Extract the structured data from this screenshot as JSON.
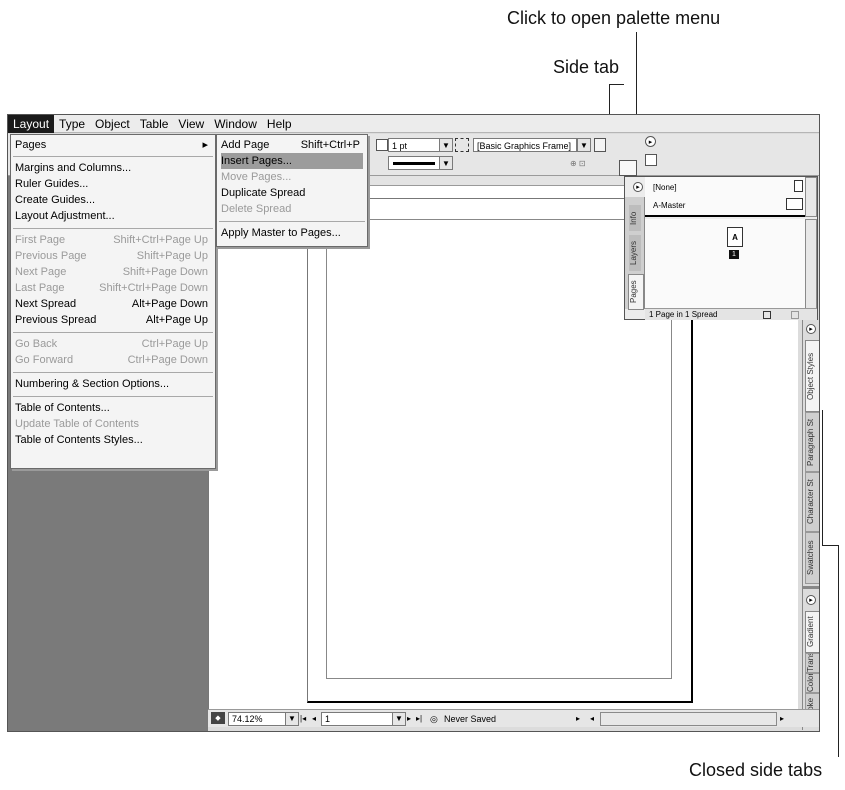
{
  "callouts": {
    "palette_menu": "Click to open palette menu",
    "side_tab": "Side tab",
    "closed_side_tabs": "Closed side tabs"
  },
  "menubar": [
    "Layout",
    "Type",
    "Object",
    "Table",
    "View",
    "Window",
    "Help"
  ],
  "layout_menu": {
    "pages": "Pages",
    "margins": "Margins and Columns...",
    "ruler_guides": "Ruler Guides...",
    "create_guides": "Create Guides...",
    "layout_adjustment": "Layout Adjustment...",
    "first_page": {
      "label": "First Page",
      "key": "Shift+Ctrl+Page Up"
    },
    "previous_page": {
      "label": "Previous Page",
      "key": "Shift+Page Up"
    },
    "next_page": {
      "label": "Next Page",
      "key": "Shift+Page Down"
    },
    "last_page": {
      "label": "Last Page",
      "key": "Shift+Ctrl+Page Down"
    },
    "next_spread": {
      "label": "Next Spread",
      "key": "Alt+Page Down"
    },
    "previous_spread": {
      "label": "Previous Spread",
      "key": "Alt+Page Up"
    },
    "go_back": {
      "label": "Go Back",
      "key": "Ctrl+Page Up"
    },
    "go_forward": {
      "label": "Go Forward",
      "key": "Ctrl+Page Down"
    },
    "numbering": "Numbering & Section Options...",
    "toc": "Table of Contents...",
    "update_toc": "Update Table of Contents",
    "toc_styles": "Table of Contents Styles..."
  },
  "pages_submenu": {
    "add_page": {
      "label": "Add Page",
      "key": "Shift+Ctrl+P"
    },
    "insert_pages": "Insert Pages...",
    "move_pages": "Move Pages...",
    "duplicate_spread": "Duplicate Spread",
    "delete_spread": "Delete Spread",
    "apply_master": "Apply Master to Pages..."
  },
  "control_panel": {
    "stroke_weight": "1 pt",
    "frame_style": "[Basic Graphics Frame]"
  },
  "pages_palette": {
    "tabs": [
      "Info",
      "Layers",
      "Pages"
    ],
    "none_label": "[None]",
    "master_label": "A-Master",
    "page_master_letter": "A",
    "page_number": "1",
    "footer": "1 Page in 1 Spread"
  },
  "side_tabs_group1": [
    "Object Styles",
    "Paragraph St",
    "Character St",
    "Swatches"
  ],
  "side_tabs_group2": [
    "Gradient",
    "Transparency",
    "Color",
    "Stroke"
  ],
  "status": {
    "zoom": "74.12%",
    "page_field": "1",
    "save_state": "Never Saved"
  }
}
